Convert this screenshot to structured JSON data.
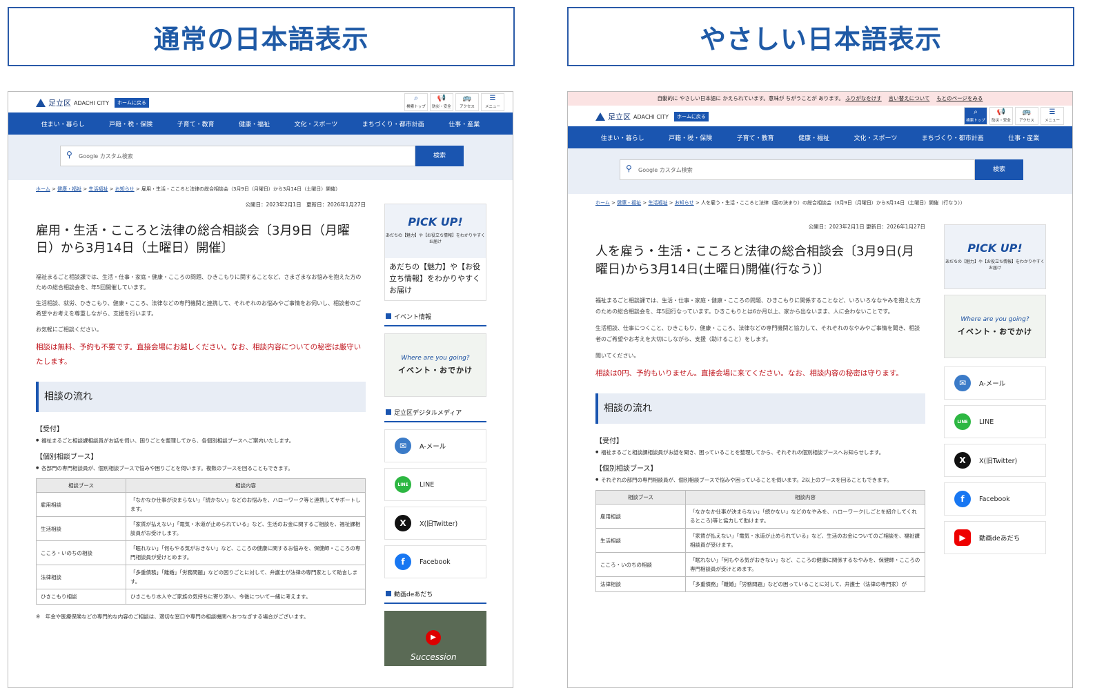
{
  "labels": {
    "normal": "通常の日本語表示",
    "easy": "やさしい日本語表示"
  },
  "site": {
    "name": "足立区",
    "city": "ADACHI CITY",
    "home": "ホームに戻る"
  },
  "tools": [
    "検索トップ",
    "防災・安全",
    "アクセス",
    "メニュー"
  ],
  "nav": [
    "住まい・暮らし",
    "戸籍・税・保険",
    "子育て・教育",
    "健康・福祉",
    "文化・スポーツ",
    "まちづくり・都市計画",
    "仕事・産業"
  ],
  "search": {
    "placeholder": "Google カスタム検索",
    "button": "検索"
  },
  "normal": {
    "breadcrumb": {
      "home": "ホーム",
      "l2": "健康・福祉",
      "l3": "生活福祉",
      "l4": "お知らせ",
      "current": "雇用・生活・こころと法律の総合相談会（3月9日（月曜日）から3月14日（土曜日）開催）"
    },
    "date": "公開日：2023年2月1日　更新日：2026年1月27日",
    "title": "雇用・生活・こころと法律の総合相談会〔3月9日（月曜日）から3月14日（土曜日）開催〕",
    "p1": "福祉まるごと相談課では、生活・仕事・家庭・健康・こころの問題、ひきこもりに関することなど、さまざまなお悩みを抱えた方のための総合相談会を、年5回開催しています。",
    "p2": "生活相談、就労、ひきこもり、健康・こころ、法律などの専門機関と連携して、それぞれのお悩みやご事情をお伺いし、相談者のご希望やお考えを尊重しながら、支援を行います。",
    "p3": "お気軽にご相談ください。",
    "red": "相談は無料、予約も不要です。直接会場にお越しください。なお、相談内容についての秘密は厳守いたします。",
    "h2": "相談の流れ",
    "h3a": "【受付】",
    "li1": "福祉まるごと相談課相談員がお話を伺い、困りごとを整理してから、各個別相談ブースへご案内いたします。",
    "h3b": "【個別相談ブース】",
    "li2": "各部門の専門相談員が、個別相談ブースで悩みや困りごとを伺います。複数のブースを回ることもできます。",
    "th": [
      "相談ブース",
      "相談内容"
    ],
    "rows": [
      [
        "雇用相談",
        "「なかなか仕事が決まらない」「続かない」などのお悩みを、ハローワーク等と連携してサポートします。"
      ],
      [
        "生活相談",
        "「家賃が払えない」「電気・水道が止められている」など、生活のお金に関するご相談を、福祉課相談員がお受けします。"
      ],
      [
        "こころ・いのちの相談",
        "「眠れない」「何もやる気がおきない」など、こころの健康に関するお悩みを、保健師・こころの専門相談員が受けとめます。"
      ],
      [
        "法律相談",
        "「多重債務」「離婚」「労務問題」などの困りごとに対して、弁護士が法律の専門家として助言します。"
      ],
      [
        "ひきこもり相談",
        "ひきこもり本人やご家族の気持ちに寄り添い、今後について一緒に考えます。"
      ]
    ],
    "note": "※　年金や医療保険などの専門的な内容のご相談は、適切な窓口や専門の相談機関へおつなぎする場合がございます。"
  },
  "easy": {
    "banner": {
      "text": "自動的に やさしい日本語に かえられています。意味が ちがうことが あります。",
      "link1": "ふりがなをけす",
      "link2": "言い替えについて",
      "link3": "もとのページをみる"
    },
    "breadcrumb": {
      "home": "ホーム",
      "l2": "健康・福祉",
      "l3": "生活福祉",
      "l4": "お知らせ",
      "current": "人を雇う・生活・こころと法律（国の決まり）の総合相談会（3月9日（月曜日）から3月14日（土曜日）開催（行なう））"
    },
    "date": "公開日：2023年2月1日 更新日：2026年1月27日",
    "title": "人を雇う・生活・こころと法律の総合相談会〔3月9日(月曜日)から3月14日(土曜日)開催(行なう)〕",
    "p1": "福祉まるごと相談課では、生活・仕事・家庭・健康・こころの問題、ひきこもりに関係することなど、いろいろななやみを抱えた方のための総合相談会を、年5回行なっています。ひきこもりとは6か月以上、家から出ないまま、人に会わないことです。",
    "p2": "生活相談、仕事につくこと、ひきこもり、健康・こころ、法律などの専門機関と協力して、それぞれのなやみやご事情を聞き、相談者のご希望やお考えを大切にしながら、支援（助けること）をします。",
    "p3": "聞いてください。",
    "red": "相談は0円、予約もいりません。直接会場に来てください。なお、相談内容の秘密は守ります。",
    "h2": "相談の流れ",
    "h3a": "【受付】",
    "li1": "福祉まるごと相談課相談員がお話を聞き、困っていることを整理してから、それぞれの個別相談ブースへお知らせします。",
    "h3b": "【個別相談ブース】",
    "li2": "それぞれの部門の専門相談員が、個別相談ブースで悩みや困っていることを伺います。2以上のブースを回ることもできます。",
    "th": [
      "相談ブース",
      "相談内容"
    ],
    "rows": [
      [
        "雇用相談",
        "「なかなか仕事が決まらない」「続かない」などのなやみを、ハローワーク(しごとを紹介してくれるところ)等と協力して助けます。"
      ],
      [
        "生活相談",
        "「家賃が払えない」「電気・水道が止められている」など、生活のお金についてのご相談を、福祉課相談員が受けます。"
      ],
      [
        "こころ・いのちの相談",
        "「眠れない」「何もやる気がおきない」など、こころの健康に関係するなやみを、保健師・こころの専門相談員が受けとめます。"
      ],
      [
        "法律相談",
        "「多重債務」「離婚」「労務問題」などの困っていることに対して、弁護士（法律の専門家）が"
      ]
    ]
  },
  "sidebar": {
    "pickup": {
      "title": "PICK UP!",
      "sub": "あだちの【魅力】や【お役立ち情報】をわかりやすくお届け",
      "text": "あだちの【魅力】や【お役立ち情報】をわかりやすくお届け"
    },
    "event_head": "イベント情報",
    "event": {
      "en": "Where are you going?",
      "jp": "イベント・おでかけ"
    },
    "media_head": "足立区デジタルメディア",
    "sns": [
      "A-メール",
      "LINE",
      "X(旧Twitter)",
      "Facebook",
      "動画deあだち"
    ],
    "video_head": "動画deあだち",
    "video_text": "Succession"
  }
}
